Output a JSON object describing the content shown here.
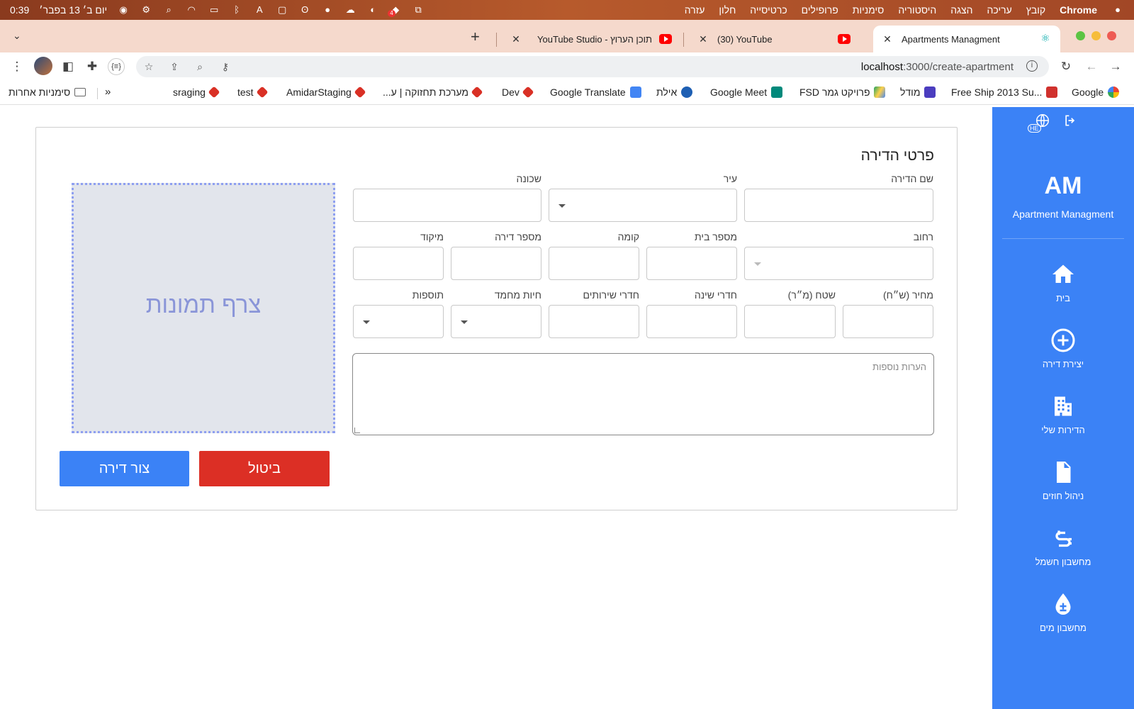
{
  "menubar": {
    "time": "0:39",
    "date": "יום ב׳ 13 בפבר׳",
    "app": "Chrome",
    "menus": [
      "קובץ",
      "עריכה",
      "הצגה",
      "היסטוריה",
      "סימניות",
      "פרופילים",
      "כרטיסייה",
      "חלון",
      "עזרה"
    ],
    "icons": [
      "siri-icon",
      "control-center-icon",
      "search-icon",
      "wifi-icon",
      "battery-icon",
      "bluetooth-icon",
      "input-source-icon",
      "display-icon",
      "hearing-icon",
      "elephant-icon",
      "cloud-icon",
      "app-icon",
      "dropbox-icon",
      "screen-icon"
    ],
    "dropbox_badge": "4"
  },
  "tabs": [
    {
      "title": "Apartments Managment",
      "active": true,
      "favicon": "react-icon"
    },
    {
      "title": "(30) YouTube",
      "active": false,
      "favicon": "youtube-icon"
    },
    {
      "title": "תוכן הערוץ - YouTube Studio",
      "active": false,
      "favicon": "youtube-icon"
    }
  ],
  "tab_new_label": "+",
  "tab_close_label": "✕",
  "address": {
    "host": "localhost",
    "path": ":3000/create-apartment"
  },
  "bookmarks": [
    {
      "label": "Google",
      "icon": "google-icon",
      "color": "#4285f4"
    },
    {
      "label": "Free Ship 2013 Su...",
      "icon": "shop-icon",
      "color": "#d0312d"
    },
    {
      "label": "מודל",
      "icon": "moodle-icon",
      "color": "#4b3dbf"
    },
    {
      "label": "פרויקט גמר FSD",
      "icon": "drive-icon",
      "color": "#1fa463"
    },
    {
      "label": "Google Meet",
      "icon": "meet-icon",
      "color": "#00897b"
    },
    {
      "label": "אילת",
      "icon": "ie-icon",
      "color": "#1e5fb3"
    },
    {
      "label": "Google Translate",
      "icon": "translate-icon",
      "color": "#4285f4"
    },
    {
      "label": "Dev",
      "icon": "tool-icon",
      "color": "#d93025"
    },
    {
      "label": "מערכת תחזוקה | ע...",
      "icon": "tool-icon",
      "color": "#d93025"
    },
    {
      "label": "AmidarStaging",
      "icon": "tool-icon",
      "color": "#d93025"
    },
    {
      "label": "test",
      "icon": "tool-icon",
      "color": "#d93025"
    },
    {
      "label": "sraging",
      "icon": "tool-icon",
      "color": "#d93025"
    }
  ],
  "bookmarks_more": "»",
  "bookmarks_other": "סימניות אחרות",
  "sidebar": {
    "lang": "HE",
    "brand": "AM",
    "brand_sub": "Apartment Managment",
    "items": [
      {
        "label": "בית",
        "icon": "home-icon"
      },
      {
        "label": "יצירת דירה",
        "icon": "add-circle-icon"
      },
      {
        "label": "הדירות שלי",
        "icon": "building-icon"
      },
      {
        "label": "ניהול חוזים",
        "icon": "document-icon"
      },
      {
        "label": "מחשבון חשמל",
        "icon": "power-plug-icon"
      },
      {
        "label": "מחשבון מים",
        "icon": "water-drop-icon"
      }
    ]
  },
  "form": {
    "title": "פרטי הדירה",
    "labels": {
      "name": "שם הדירה",
      "city": "עיר",
      "neighborhood": "שכונה",
      "street": "רחוב",
      "house_number": "מספר בית",
      "floor": "קומה",
      "apt_number": "מספר דירה",
      "zip": "מיקוד",
      "price": "מחיר (ש״ח)",
      "area": "שטח (מ״ר)",
      "bedrooms": "חדרי שינה",
      "bathrooms": "חדרי שירותים",
      "safe_room": "חיות מחמד",
      "extras": "תוספות"
    },
    "notes_placeholder": "הערות נוספות",
    "dropzone_text": "צרף תמונות",
    "cancel_label": "ביטול",
    "create_label": "צור דירה"
  },
  "colors": {
    "primary": "#3b82f6",
    "danger": "#dc2f25",
    "dropzone_bg": "#e2e5ec",
    "dropzone_border": "#8e9ff0"
  }
}
